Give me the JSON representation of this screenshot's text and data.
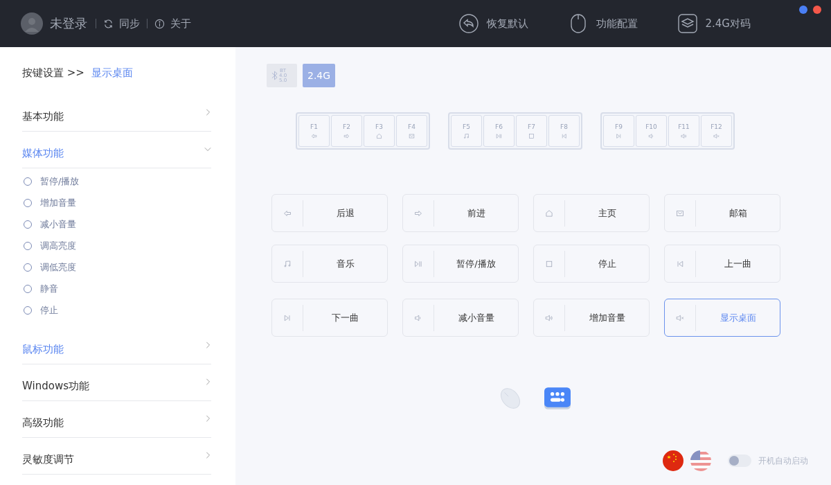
{
  "header": {
    "user": "未登录",
    "links": [
      {
        "kind": "sync",
        "label": "同步"
      },
      {
        "kind": "info",
        "label": "关于"
      }
    ],
    "actions": [
      {
        "kind": "restore",
        "label": "恢复默认"
      },
      {
        "kind": "mouse",
        "label": "功能配置"
      },
      {
        "kind": "layers",
        "label": "2.4G对码"
      }
    ],
    "window_dots": [
      {
        "color": "#4a7ff5"
      },
      {
        "color": "#f5584a"
      }
    ]
  },
  "sidebar": {
    "breadcrumb": {
      "path": "按键设置 >>",
      "current": "显示桌面"
    },
    "sections": [
      {
        "label": "基本功能",
        "expanded": false,
        "selected": false
      },
      {
        "label": "媒体功能",
        "expanded": true,
        "selected": true,
        "children": [
          {
            "label": "暂停/播放",
            "checked": false
          },
          {
            "label": "增加音量",
            "checked": false
          },
          {
            "label": "减小音量",
            "checked": false
          },
          {
            "label": "调高亮度",
            "checked": false
          },
          {
            "label": "调低亮度",
            "checked": false
          },
          {
            "label": "静音",
            "checked": false
          },
          {
            "label": "停止",
            "checked": false
          }
        ]
      },
      {
        "label": "鼠标功能",
        "expanded": false,
        "selected": true
      },
      {
        "label": "Windows功能",
        "expanded": false,
        "selected": false
      },
      {
        "label": "高级功能",
        "expanded": false,
        "selected": false
      },
      {
        "label": "灵敏度调节",
        "expanded": false,
        "selected": false
      }
    ]
  },
  "modes": [
    {
      "kind": "bt",
      "lines": [
        "BT",
        "4.0",
        "5.0"
      ],
      "selected": false
    },
    {
      "kind": "text",
      "label": "2.4G",
      "selected": true
    }
  ],
  "key_groups": [
    [
      {
        "label": "F1",
        "kind": "back"
      },
      {
        "label": "F2",
        "kind": "forward"
      },
      {
        "label": "F3",
        "kind": "home"
      },
      {
        "label": "F4",
        "kind": "mail"
      }
    ],
    [
      {
        "label": "F5",
        "kind": "music"
      },
      {
        "label": "F6",
        "kind": "playpause"
      },
      {
        "label": "F7",
        "kind": "stop"
      },
      {
        "label": "F8",
        "kind": "prev"
      }
    ],
    [
      {
        "label": "F9",
        "kind": "next"
      },
      {
        "label": "F10",
        "kind": "voldown"
      },
      {
        "label": "F11",
        "kind": "volup"
      },
      {
        "label": "F12",
        "kind": "mute"
      }
    ]
  ],
  "functions": [
    {
      "label": "后退",
      "kind": "back",
      "selected": false
    },
    {
      "label": "前进",
      "kind": "forward",
      "selected": false
    },
    {
      "label": "主页",
      "kind": "home",
      "selected": false
    },
    {
      "label": "邮箱",
      "kind": "mail",
      "selected": false
    },
    {
      "label": "音乐",
      "kind": "music",
      "selected": false
    },
    {
      "label": "暂停/播放",
      "kind": "playpause",
      "selected": false
    },
    {
      "label": "停止",
      "kind": "stop",
      "selected": false
    },
    {
      "label": "上一曲",
      "kind": "prev",
      "selected": false
    },
    {
      "label": "下一曲",
      "kind": "next",
      "selected": false
    },
    {
      "label": "减小音量",
      "kind": "voldown",
      "selected": false
    },
    {
      "label": "增加音量",
      "kind": "volup",
      "selected": false
    },
    {
      "label": "显示桌面",
      "kind": "mute",
      "selected": true
    }
  ],
  "devices": [
    {
      "kind": "mouse",
      "selected": false
    },
    {
      "kind": "keyboard",
      "selected": true
    }
  ],
  "languages": [
    {
      "kind": "cn",
      "selected": true
    },
    {
      "kind": "us",
      "selected": false
    }
  ],
  "autostart": {
    "label": "开机自动启动",
    "on": false
  }
}
